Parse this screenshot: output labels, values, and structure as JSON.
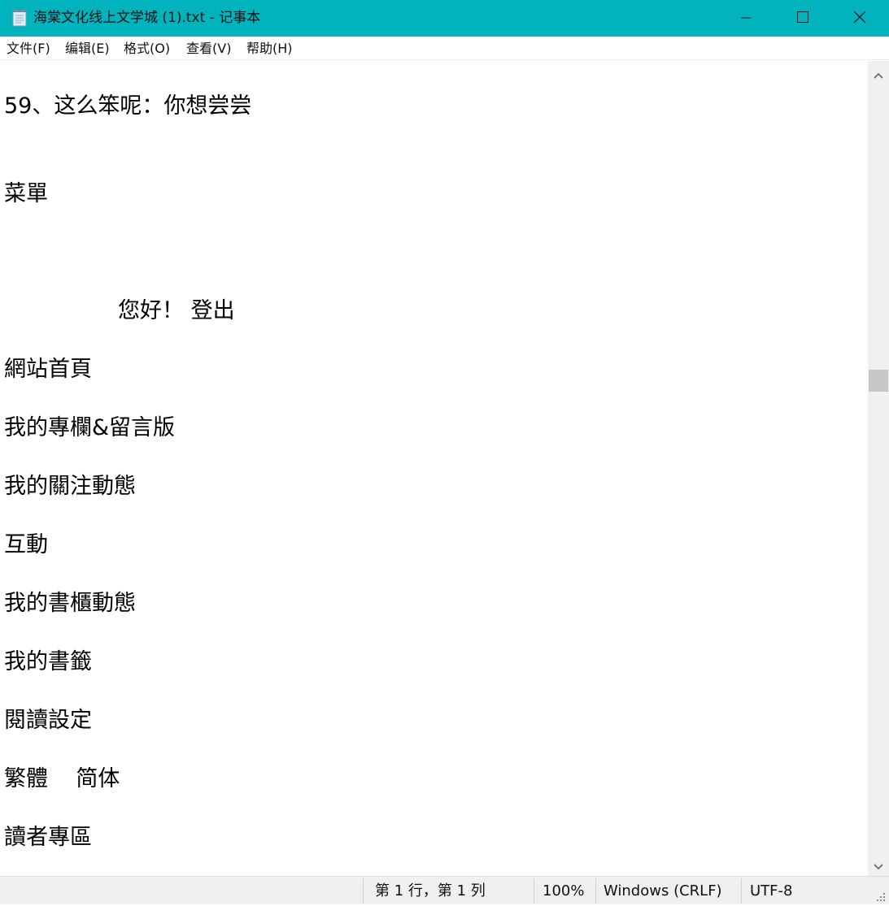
{
  "window": {
    "title": "海棠文化线上文学城 (1).txt - 记事本"
  },
  "menu": {
    "items": [
      "文件(F)",
      "编辑(E)",
      "格式(O)",
      "查看(V)",
      "帮助(H)"
    ]
  },
  "editor": {
    "lines": [
      "59、这么笨呢：你想尝尝",
      "菜單",
      "您好！    登出",
      "網站首頁",
      "我的專欄&留言版",
      "我的關注動態",
      "互動",
      "我的書櫃動態",
      "我的書籤",
      "閱讀設定",
      "繁體    简体",
      "讀者專區"
    ]
  },
  "status": {
    "position": "第 1 行，第 1 列",
    "zoom": "100%",
    "line_ending": "Windows (CRLF)",
    "encoding": "UTF-8"
  },
  "icons": {
    "app": "notepad-icon",
    "minimize": "minimize-icon",
    "maximize": "maximize-icon",
    "close": "close-icon",
    "scroll_up": "chevron-up-icon",
    "scroll_down": "chevron-down-icon",
    "grip": "resize-grip-icon"
  },
  "colors": {
    "titlebar": "#00b3bd",
    "statusbar": "#f0f0f0",
    "scroll_thumb": "#c7c7c7"
  }
}
